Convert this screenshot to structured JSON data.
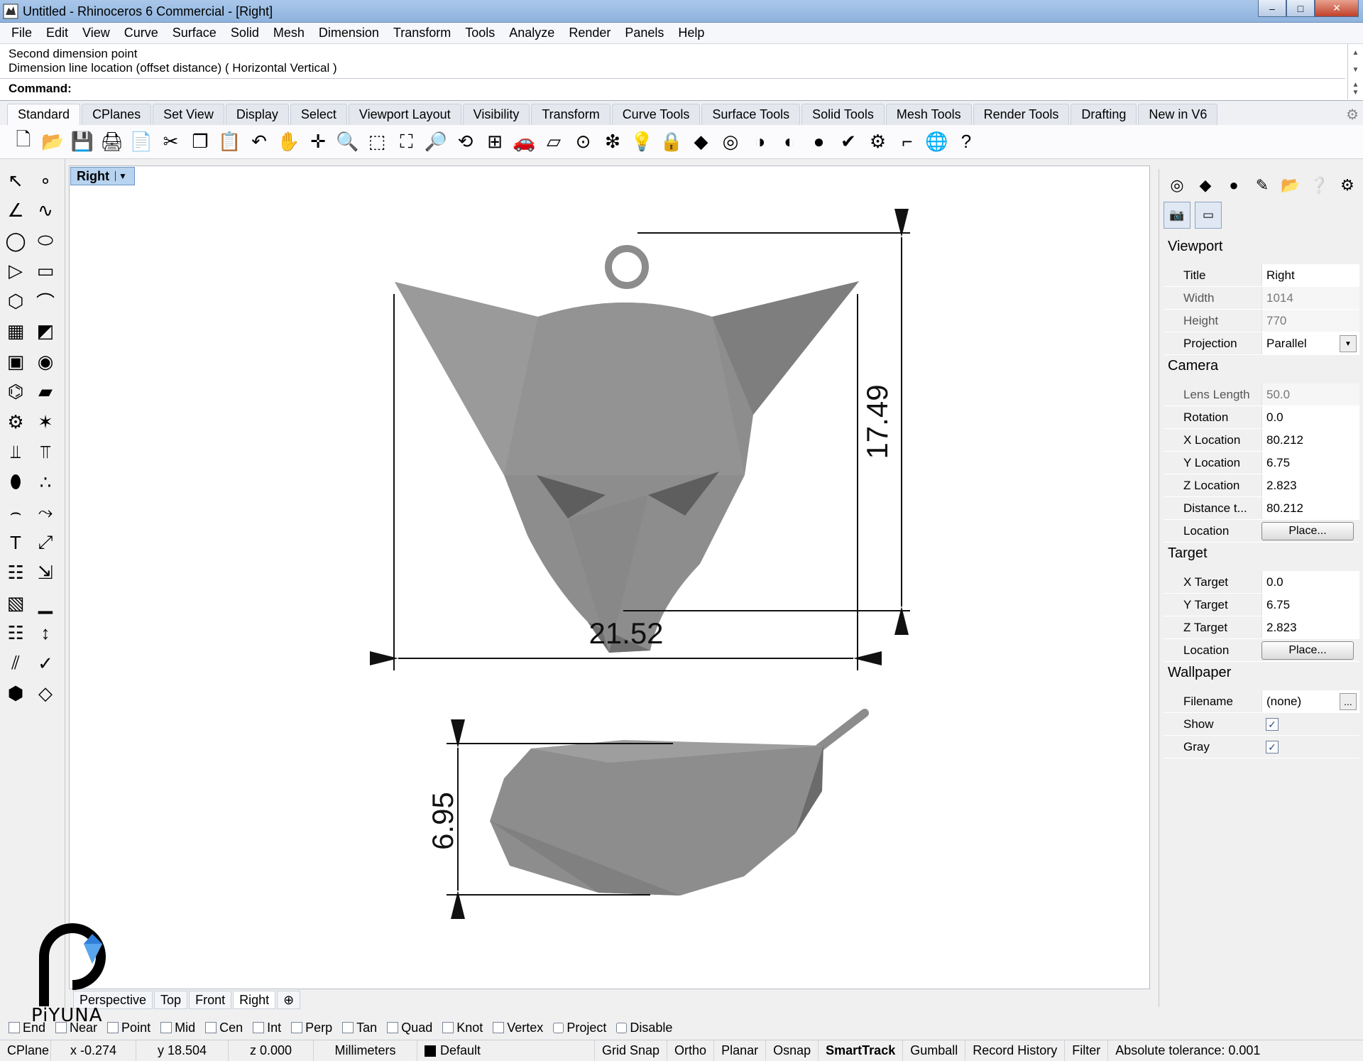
{
  "window": {
    "title": "Untitled - Rhinoceros 6 Commercial - [Right]",
    "min_glyph": "–",
    "max_glyph": "□",
    "close_glyph": "✕"
  },
  "menubar": [
    "File",
    "Edit",
    "View",
    "Curve",
    "Surface",
    "Solid",
    "Mesh",
    "Dimension",
    "Transform",
    "Tools",
    "Analyze",
    "Render",
    "Panels",
    "Help"
  ],
  "command": {
    "history": [
      "Second dimension point",
      "Dimension line location (offset distance) ( Horizontal  Vertical )"
    ],
    "prompt_label": "Command:",
    "value": ""
  },
  "toolbar_tabs": [
    "Standard",
    "CPlanes",
    "Set View",
    "Display",
    "Select",
    "Viewport Layout",
    "Visibility",
    "Transform",
    "Curve Tools",
    "Surface Tools",
    "Solid Tools",
    "Mesh Tools",
    "Render Tools",
    "Drafting",
    "New in V6"
  ],
  "active_toolbar_tab": "Standard",
  "standard_tools": [
    {
      "name": "new-icon",
      "glyph": "🗋"
    },
    {
      "name": "open-icon",
      "glyph": "📂"
    },
    {
      "name": "save-icon",
      "glyph": "💾"
    },
    {
      "name": "print-icon",
      "glyph": "🖨"
    },
    {
      "name": "import-icon",
      "glyph": "📄"
    },
    {
      "name": "cut-icon",
      "glyph": "✂"
    },
    {
      "name": "copy-icon",
      "glyph": "❐"
    },
    {
      "name": "paste-icon",
      "glyph": "📋"
    },
    {
      "name": "undo-icon",
      "glyph": "↶"
    },
    {
      "name": "pan-icon",
      "glyph": "✋"
    },
    {
      "name": "rotate-view-icon",
      "glyph": "✛"
    },
    {
      "name": "zoom-icon",
      "glyph": "🔍"
    },
    {
      "name": "zoom-window-icon",
      "glyph": "⬚"
    },
    {
      "name": "zoom-extents-icon",
      "glyph": "⛶"
    },
    {
      "name": "zoom-selected-icon",
      "glyph": "🔎"
    },
    {
      "name": "undo-view-icon",
      "glyph": "⟲"
    },
    {
      "name": "four-viewports-icon",
      "glyph": "⊞"
    },
    {
      "name": "car-icon",
      "glyph": "🚗"
    },
    {
      "name": "grid-plane-icon",
      "glyph": "▱"
    },
    {
      "name": "osnap-icon",
      "glyph": "⊙"
    },
    {
      "name": "select-points-icon",
      "glyph": "❇"
    },
    {
      "name": "light-icon",
      "glyph": "💡"
    },
    {
      "name": "lock-icon",
      "glyph": "🔒"
    },
    {
      "name": "layers-icon",
      "glyph": "◆"
    },
    {
      "name": "color-wheel-icon",
      "glyph": "◎"
    },
    {
      "name": "shaded-sphere-icon",
      "glyph": "◑"
    },
    {
      "name": "rendered-sphere-icon",
      "glyph": "◐"
    },
    {
      "name": "render-icon",
      "glyph": "●"
    },
    {
      "name": "paint-icon",
      "glyph": "✔"
    },
    {
      "name": "options-gear-icon",
      "glyph": "⚙"
    },
    {
      "name": "dimension-icon",
      "glyph": "⌐"
    },
    {
      "name": "globe-icon",
      "glyph": "🌐"
    },
    {
      "name": "help-icon",
      "glyph": "?"
    }
  ],
  "left_palette": [
    {
      "name": "select-arrow-icon",
      "glyph": "↖"
    },
    {
      "name": "point-icon",
      "glyph": "∘"
    },
    {
      "name": "polyline-icon",
      "glyph": "∠"
    },
    {
      "name": "curve-cv-icon",
      "glyph": "∿"
    },
    {
      "name": "circle-icon",
      "glyph": "◯"
    },
    {
      "name": "ellipse-icon",
      "glyph": "⬭"
    },
    {
      "name": "arc-icon",
      "glyph": "▷"
    },
    {
      "name": "rectangle-icon",
      "glyph": "▭"
    },
    {
      "name": "polygon-icon",
      "glyph": "⬡"
    },
    {
      "name": "fillet-curve-icon",
      "glyph": "⌒"
    },
    {
      "name": "surface-points-icon",
      "glyph": "▦"
    },
    {
      "name": "loft-icon",
      "glyph": "◩"
    },
    {
      "name": "box-icon",
      "glyph": "▣"
    },
    {
      "name": "sphere-icon",
      "glyph": "◉"
    },
    {
      "name": "cylinder-icon",
      "glyph": "⌬"
    },
    {
      "name": "planar-surface-icon",
      "glyph": "▰"
    },
    {
      "name": "gear-solid-icon",
      "glyph": "⚙"
    },
    {
      "name": "explode-icon",
      "glyph": "✶"
    },
    {
      "name": "split-icon",
      "glyph": "⫫"
    },
    {
      "name": "trim-icon",
      "glyph": "⫪"
    },
    {
      "name": "boolean-union-icon",
      "glyph": "⬮"
    },
    {
      "name": "boolean-split-icon",
      "glyph": "∴"
    },
    {
      "name": "fillet-edge-icon",
      "glyph": "⌢"
    },
    {
      "name": "offset-curve-icon",
      "glyph": "⤳"
    },
    {
      "name": "text-icon",
      "glyph": "T"
    },
    {
      "name": "scale-icon",
      "glyph": "⤢"
    },
    {
      "name": "array-icon",
      "glyph": "☷"
    },
    {
      "name": "orient-icon",
      "glyph": "⇲"
    },
    {
      "name": "cage-icon",
      "glyph": "▧"
    },
    {
      "name": "ruler-icon",
      "glyph": "▁"
    },
    {
      "name": "grid-array-icon",
      "glyph": "☷"
    },
    {
      "name": "distance-icon",
      "glyph": "↕"
    },
    {
      "name": "flow-icon",
      "glyph": "⫽"
    },
    {
      "name": "check-icon",
      "glyph": "✓"
    },
    {
      "name": "mesh-icon",
      "glyph": "⬢"
    },
    {
      "name": "render-mesh-icon",
      "glyph": "◇"
    }
  ],
  "viewport": {
    "title": "Right",
    "dimensions": {
      "width": "21.52",
      "height": "17.49",
      "depth": "6.95"
    }
  },
  "viewport_tabs": [
    "Perspective",
    "Top",
    "Front",
    "Right"
  ],
  "active_viewport_tab": "Right",
  "add_tab_glyph": "⊕",
  "right_panel": {
    "icons": [
      {
        "name": "properties-color-icon",
        "glyph": "◎"
      },
      {
        "name": "layers-panel-icon",
        "glyph": "◆"
      },
      {
        "name": "materials-icon",
        "glyph": "●"
      },
      {
        "name": "display-brush-icon",
        "glyph": "✎"
      },
      {
        "name": "libraries-folder-icon",
        "glyph": "📂"
      },
      {
        "name": "help-panel-icon",
        "glyph": "❔"
      },
      {
        "name": "panel-gear-icon",
        "glyph": "⚙"
      }
    ],
    "sub_icons": [
      {
        "name": "camera-icon",
        "glyph": "📷"
      },
      {
        "name": "frame-icon",
        "glyph": "▭"
      }
    ],
    "viewport_section": "Viewport",
    "viewport_rows": [
      {
        "label": "Title",
        "value": "Right",
        "dim": false
      },
      {
        "label": "Width",
        "value": "1014",
        "dim": true
      },
      {
        "label": "Height",
        "value": "770",
        "dim": true
      },
      {
        "label": "Projection",
        "value": "Parallel",
        "dim": false
      }
    ],
    "camera_section": "Camera",
    "camera_rows": [
      {
        "label": "Lens Length",
        "value": "50.0",
        "dim": true
      },
      {
        "label": "Rotation",
        "value": "0.0",
        "dim": false
      },
      {
        "label": "X Location",
        "value": "80.212",
        "dim": false
      },
      {
        "label": "Y Location",
        "value": "6.75",
        "dim": false
      },
      {
        "label": "Z Location",
        "value": "2.823",
        "dim": false
      },
      {
        "label": "Distance t...",
        "value": "80.212",
        "dim": false
      }
    ],
    "camera_location_label": "Location",
    "place_button": "Place...",
    "target_section": "Target",
    "target_rows": [
      {
        "label": "X Target",
        "value": "0.0"
      },
      {
        "label": "Y Target",
        "value": "6.75"
      },
      {
        "label": "Z Target",
        "value": "2.823"
      }
    ],
    "target_location_label": "Location",
    "wallpaper_section": "Wallpaper",
    "filename_label": "Filename",
    "filename_value": "(none)",
    "browse_button": "...",
    "show_label": "Show",
    "gray_label": "Gray",
    "show_checked": true,
    "gray_checked": true,
    "check_glyph": "✓"
  },
  "osnaps": [
    {
      "label": "End",
      "checked": false
    },
    {
      "label": "Near",
      "checked": false
    },
    {
      "label": "Point",
      "checked": false
    },
    {
      "label": "Mid",
      "checked": false
    },
    {
      "label": "Cen",
      "checked": false
    },
    {
      "label": "Int",
      "checked": false
    },
    {
      "label": "Perp",
      "checked": false
    },
    {
      "label": "Tan",
      "checked": false
    },
    {
      "label": "Quad",
      "checked": false
    },
    {
      "label": "Knot",
      "checked": false
    },
    {
      "label": "Vertex",
      "checked": false
    },
    {
      "label": "Project",
      "checked": false,
      "round": true
    },
    {
      "label": "Disable",
      "checked": false,
      "round": true
    }
  ],
  "statusbar": {
    "cplane": "CPlane",
    "x": "x -0.274",
    "y": "y 18.504",
    "z": "z 0.000",
    "units": "Millimeters",
    "layer": "Default",
    "toggles": [
      "Grid Snap",
      "Ortho",
      "Planar",
      "Osnap",
      "SmartTrack",
      "Gumball",
      "Record History",
      "Filter"
    ],
    "active_toggle": "SmartTrack",
    "tolerance": "Absolute tolerance: 0.001"
  },
  "watermark": {
    "brand": "PiYUNA",
    "accent_color": "#2f7fd8"
  },
  "colors": {
    "viewport_bg": "#ffffff",
    "model_gray": "#8c8c8c",
    "title_blue": "#b7d3ef"
  }
}
